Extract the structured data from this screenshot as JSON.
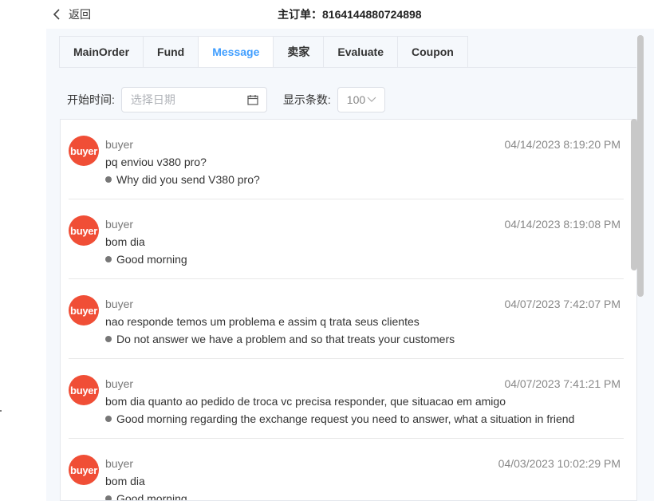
{
  "header": {
    "back_label": "返回",
    "order_title": "主订单：8164144880724898"
  },
  "tabs": [
    {
      "label": "MainOrder"
    },
    {
      "label": "Fund"
    },
    {
      "label": "Message"
    },
    {
      "label": "卖家"
    },
    {
      "label": "Evaluate"
    },
    {
      "label": "Coupon"
    }
  ],
  "active_tab": "Message",
  "filters": {
    "start_time_label": "开始时间:",
    "date_placeholder": "选择日期",
    "count_label": "显示条数:",
    "count_value": "100"
  },
  "messages": [
    {
      "avatar": "buyer",
      "sender": "buyer",
      "time": "04/14/2023 8:19:20 PM",
      "original": "pq enviou v380 pro?",
      "translation": "Why did you send V380 pro?"
    },
    {
      "avatar": "buyer",
      "sender": "buyer",
      "time": "04/14/2023 8:19:08 PM",
      "original": "bom dia",
      "translation": "Good morning"
    },
    {
      "avatar": "buyer",
      "sender": "buyer",
      "time": "04/07/2023 7:42:07 PM",
      "original": "nao responde temos um problema e assim q trata seus clientes",
      "translation": "Do not answer we have a problem and so that treats your customers"
    },
    {
      "avatar": "buyer",
      "sender": "buyer",
      "time": "04/07/2023 7:41:21 PM",
      "original": "bom dia quanto ao pedido de troca vc precisa responder, que situacao em amigo",
      "translation": "Good morning regarding the exchange request you need to answer, what a situation in friend"
    },
    {
      "avatar": "buyer",
      "sender": "buyer",
      "time": "04/03/2023 10:02:29 PM",
      "original": "bom dia",
      "translation": "Good morning"
    }
  ],
  "colors": {
    "accent": "#409eff",
    "avatar_bg": "#f04e36",
    "panel_bg": "#f5f8fc"
  },
  "icons": {
    "back": "chevron-left-icon",
    "calendar": "calendar-icon",
    "dropdown": "chevron-down-icon",
    "bullet": "dot-icon"
  }
}
